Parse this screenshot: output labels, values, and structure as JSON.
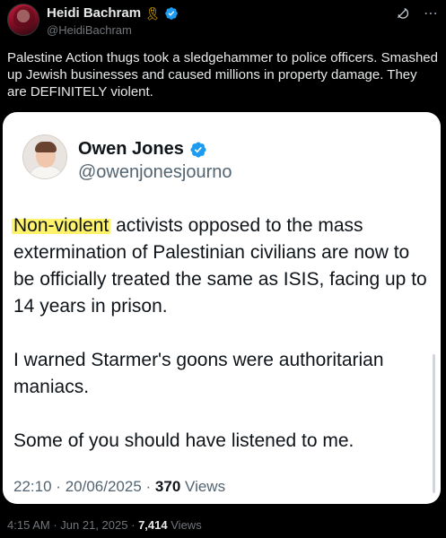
{
  "post": {
    "author_name": "Heidi Bachram",
    "author_handle": "@HeidiBachram",
    "ribbon_icon": "yellow-ribbon-icon",
    "text": "Palestine Action thugs took a sledgehammer to police officers. Smashed up Jewish businesses and caused millions in property damage. They are DEFINITELY violent.",
    "time": "4:15 AM",
    "date": "Jun 21, 2025",
    "separator": "·",
    "views_count": "7,414",
    "views_label": "Views",
    "icons": [
      "grok-icon",
      "more-options-icon"
    ]
  },
  "quote": {
    "author_name": "Owen Jones",
    "author_handle": "@owenjonesjourno",
    "highlighted_text": "Non-violent",
    "paragraph1_rest": " activists opposed to the mass extermination of Palestinian civilians are now to be officially treated the same as ISIS, facing up to 14 years in prison.",
    "paragraph2": "I warned Starmer's goons were authoritarian maniacs.",
    "paragraph3": "Some of you should have listened to me.",
    "time": "22:10",
    "date": "20/06/2025",
    "separator": "·",
    "views_count": "370",
    "views_label": "Views"
  },
  "colors": {
    "background": "#000000",
    "verified_blue": "#1d9bf0",
    "highlight": "#fff36b",
    "ribbon": "#f2b705"
  }
}
